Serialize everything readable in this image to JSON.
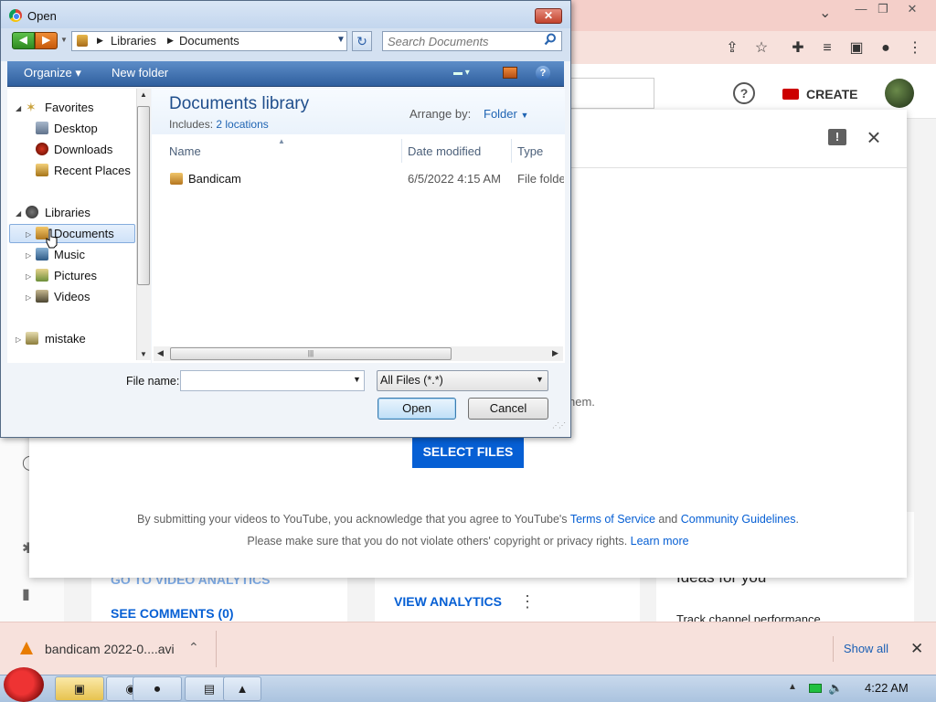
{
  "chrome": {
    "minimize": "—",
    "restore": "❐",
    "close": "✕",
    "tab_chevron": "⌄",
    "toolbar_icons": [
      "share-icon",
      "star-icon",
      "extensions-icon",
      "media-icon",
      "sidepanel-icon",
      "profile-icon",
      "menu-icon"
    ]
  },
  "youtube": {
    "header": {
      "help": "?",
      "create_label": "CREATE"
    },
    "background": {
      "video_analytics_ghost": "GO TO VIDEO ANALYTICS",
      "see_comments": "SEE COMMENTS (0)",
      "view_analytics": "VIEW ANALYTICS",
      "ideas_ghost": "Ideas for you",
      "track_performance": "Track channel performance"
    },
    "upload_modal": {
      "ghost_line1": "d",
      "ghost_line2": "hem.",
      "select_files": "SELECT FILES",
      "tos_prefix": "By submitting your videos to YouTube, you acknowledge that you agree to YouTube's ",
      "tos_link": "Terms of Service",
      "tos_and": " and ",
      "guidelines_link": "Community Guidelines",
      "tos_suffix": ".",
      "copyright_text": "Please make sure that you do not violate others' copyright or privacy rights. ",
      "learn_more": "Learn more"
    }
  },
  "download_bar": {
    "file_name": "bandicam 2022-0....avi",
    "show_all": "Show all"
  },
  "taskbar": {
    "clock": "4:22 AM"
  },
  "dialog": {
    "title": "Open",
    "address": {
      "crumbs": [
        "Libraries",
        "Documents"
      ]
    },
    "search_placeholder": "Search Documents",
    "commands": {
      "organize": "Organize ▾",
      "new_folder": "New folder"
    },
    "nav": {
      "favorites": "Favorites",
      "desktop": "Desktop",
      "downloads": "Downloads",
      "recent_places": "Recent Places",
      "libraries": "Libraries",
      "documents": "Documents",
      "music": "Music",
      "pictures": "Pictures",
      "videos": "Videos",
      "mistake": "mistake"
    },
    "library": {
      "title": "Documents library",
      "includes_label": "Includes: ",
      "includes_link": "2 locations",
      "arrange_label": "Arrange by:",
      "arrange_value": "Folder"
    },
    "columns": [
      "Name",
      "Date modified",
      "Type"
    ],
    "files": [
      {
        "name": "Bandicam",
        "date": "6/5/2022 4:15 AM",
        "type": "File folder"
      }
    ],
    "file_name_label": "File name:",
    "file_name_value": "",
    "file_type": "All Files (*.*)",
    "open_label": "Open",
    "cancel_label": "Cancel"
  },
  "colors": {
    "yt_blue": "#065fd4",
    "dialog_command_bar": "#3f6fae",
    "chrome_frame": "#f4cfc9"
  }
}
